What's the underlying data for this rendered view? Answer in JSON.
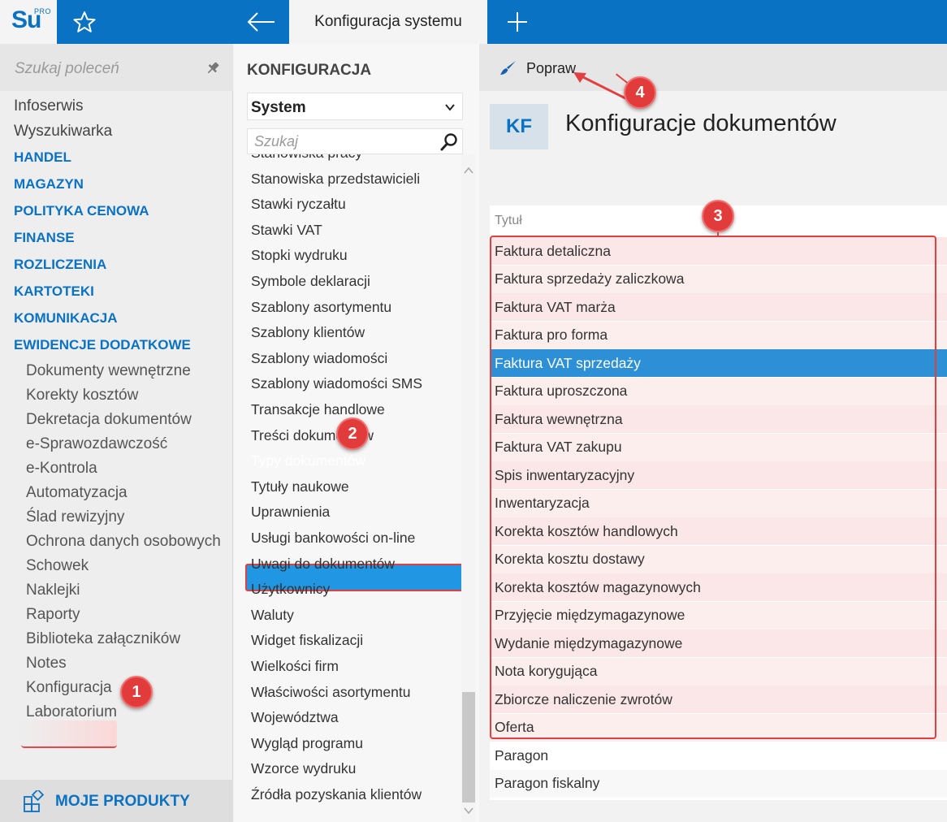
{
  "app": {
    "logo": "Su",
    "logo_suffix": "PRO",
    "active_tab": "Konfiguracja systemu"
  },
  "sidebar": {
    "search_placeholder": "Szukaj poleceń",
    "items": [
      {
        "label": "Infoserwis",
        "kind": "link"
      },
      {
        "label": "Wyszukiwarka",
        "kind": "link"
      },
      {
        "label": "HANDEL",
        "kind": "section"
      },
      {
        "label": "MAGAZYN",
        "kind": "section"
      },
      {
        "label": "POLITYKA CENOWA",
        "kind": "section"
      },
      {
        "label": "FINANSE",
        "kind": "section"
      },
      {
        "label": "ROZLICZENIA",
        "kind": "section"
      },
      {
        "label": "KARTOTEKI",
        "kind": "section"
      },
      {
        "label": "KOMUNIKACJA",
        "kind": "section"
      },
      {
        "label": "EWIDENCJE DODATKOWE",
        "kind": "section"
      },
      {
        "label": "Dokumenty wewnętrzne",
        "kind": "sub"
      },
      {
        "label": "Korekty kosztów",
        "kind": "sub"
      },
      {
        "label": "Dekretacja dokumentów",
        "kind": "sub"
      },
      {
        "label": "e-Sprawozdawczość",
        "kind": "sub"
      },
      {
        "label": "e-Kontrola",
        "kind": "sub"
      },
      {
        "label": "Automatyzacja",
        "kind": "sub"
      },
      {
        "label": "Ślad rewizyjny",
        "kind": "sub"
      },
      {
        "label": "Ochrona danych osobowych",
        "kind": "sub"
      },
      {
        "label": "Schowek",
        "kind": "sub"
      },
      {
        "label": "Naklejki",
        "kind": "sub"
      },
      {
        "label": "Raporty",
        "kind": "sub"
      },
      {
        "label": "Biblioteka załączników",
        "kind": "sub"
      },
      {
        "label": "Notes",
        "kind": "sub"
      },
      {
        "label": "Konfiguracja",
        "kind": "sub"
      },
      {
        "label": "Laboratorium",
        "kind": "sub"
      }
    ],
    "footer_label": "MOJE PRODUKTY"
  },
  "config_panel": {
    "title": "KONFIGURACJA",
    "selected_category": "System",
    "search_placeholder": "Szukaj",
    "items": [
      "Stanowiska pracy",
      "Stanowiska przedstawicieli",
      "Stawki ryczałtu",
      "Stawki VAT",
      "Stopki wydruku",
      "Symbole deklaracji",
      "Szablony asortymentu",
      "Szablony klientów",
      "Szablony wiadomości",
      "Szablony wiadomości SMS",
      "Transakcje handlowe",
      "Treści dokumentów",
      "Typy dokumentów",
      "Tytuły naukowe",
      "Uprawnienia",
      "Usługi bankowości on-line",
      "Uwagi do dokumentów",
      "Użytkownicy",
      "Waluty",
      "Widget fiskalizacji",
      "Wielkości firm",
      "Właściwości asortymentu",
      "Województwa",
      "Wygląd programu",
      "Wzorce wydruku",
      "Źródła pozyskania klientów"
    ],
    "selected_item": "Typy dokumentów"
  },
  "main": {
    "edit_label": "Popraw",
    "badge": "KF",
    "title": "Konfiguracje dokumentów",
    "column_header": "Tytuł",
    "rows": [
      "Faktura detaliczna",
      "Faktura sprzedaży zaliczkowa",
      "Faktura VAT marża",
      "Faktura pro forma",
      "Faktura VAT sprzedaży",
      "Faktura uproszczona",
      "Faktura wewnętrzna",
      "Faktura VAT zakupu",
      "Spis inwentaryzacyjny",
      "Inwentaryzacja",
      "Korekta kosztów handlowych",
      "Korekta kosztu dostawy",
      "Korekta kosztów magazynowych",
      "Przyjęcie międzymagazynowe",
      "Wydanie międzymagazynowe",
      "Nota korygująca",
      "Zbiorcze naliczenie zwrotów",
      "Oferta",
      "Paragon",
      "Paragon fiskalny"
    ],
    "selected_row": "Faktura VAT sprzedaży"
  },
  "callouts": [
    "1",
    "2",
    "3",
    "4"
  ],
  "colors": {
    "brand": "#0a72c2",
    "selection": "#2196e3",
    "callout": "#e23b3b"
  }
}
